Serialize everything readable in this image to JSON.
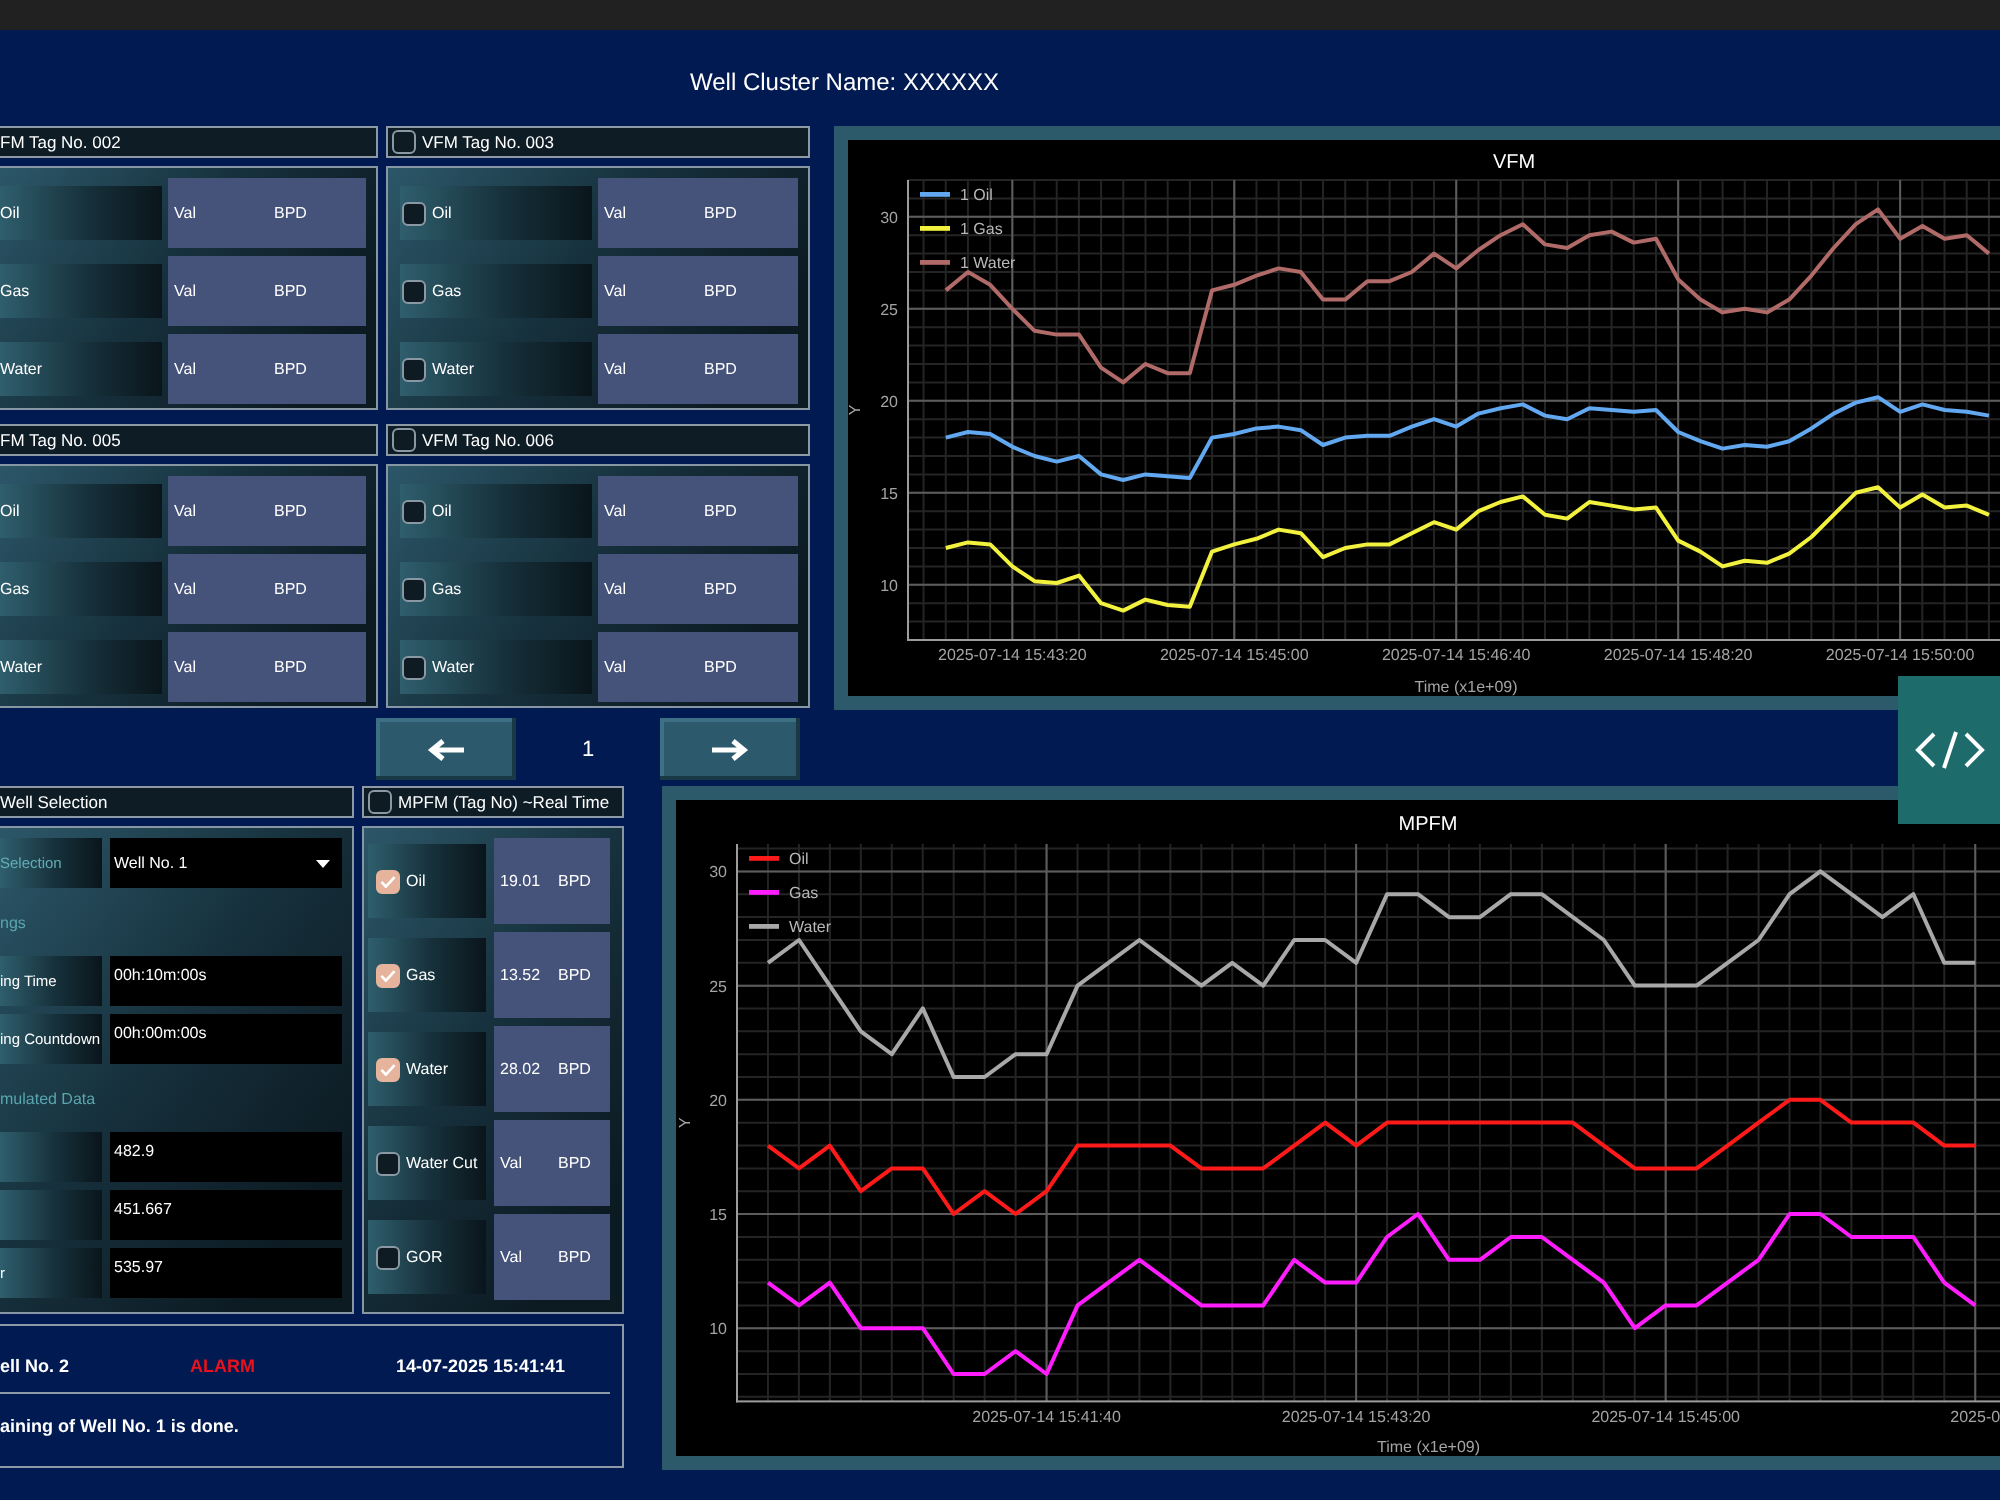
{
  "header": {
    "title": "Well Cluster Name: XXXXXX"
  },
  "vfm_panels": [
    {
      "title": "FM Tag No. 002",
      "rows": [
        {
          "label": "Oil",
          "value": "Val",
          "unit": "BPD"
        },
        {
          "label": "Gas",
          "value": "Val",
          "unit": "BPD"
        },
        {
          "label": "Water",
          "value": "Val",
          "unit": "BPD"
        }
      ]
    },
    {
      "title": "VFM Tag No. 003",
      "checked": false,
      "rows": [
        {
          "label": "Oil",
          "checked": false,
          "value": "Val",
          "unit": "BPD"
        },
        {
          "label": "Gas",
          "checked": false,
          "value": "Val",
          "unit": "BPD"
        },
        {
          "label": "Water",
          "checked": false,
          "value": "Val",
          "unit": "BPD"
        }
      ]
    },
    {
      "title": "FM Tag No. 005",
      "rows": [
        {
          "label": "Oil",
          "value": "Val",
          "unit": "BPD"
        },
        {
          "label": "Gas",
          "value": "Val",
          "unit": "BPD"
        },
        {
          "label": "Water",
          "value": "Val",
          "unit": "BPD"
        }
      ]
    },
    {
      "title": "VFM Tag No. 006",
      "checked": false,
      "rows": [
        {
          "label": "Oil",
          "checked": false,
          "value": "Val",
          "unit": "BPD"
        },
        {
          "label": "Gas",
          "checked": false,
          "value": "Val",
          "unit": "BPD"
        },
        {
          "label": "Water",
          "checked": false,
          "value": "Val",
          "unit": "BPD"
        }
      ]
    }
  ],
  "pager": {
    "page": "1"
  },
  "well_selection": {
    "title": "Well Selection",
    "rows": [
      {
        "kind": "dropdown",
        "label": "Selection",
        "value": "Well No. 1"
      },
      {
        "kind": "heading",
        "label": "ngs"
      },
      {
        "kind": "input",
        "label": "ing Time",
        "value": "00h:10m:00s"
      },
      {
        "kind": "readout",
        "label": "ing Countdown",
        "value": "00h:00m:00s"
      },
      {
        "kind": "heading",
        "label": "mulated Data"
      },
      {
        "kind": "readout",
        "value": "482.9"
      },
      {
        "kind": "readout",
        "value": "451.667"
      },
      {
        "kind": "readout",
        "label": "r",
        "value": "535.97"
      }
    ]
  },
  "mpfm_panel": {
    "title": "MPFM (Tag No) ~Real Time",
    "checked": false,
    "rows": [
      {
        "label": "Oil",
        "checked": true,
        "value": "19.01",
        "unit": "BPD"
      },
      {
        "label": "Gas",
        "checked": true,
        "value": "13.52",
        "unit": "BPD"
      },
      {
        "label": "Water",
        "checked": true,
        "value": "28.02",
        "unit": "BPD"
      },
      {
        "label": "Water Cut",
        "checked": false,
        "value": "Val",
        "unit": "BPD"
      },
      {
        "label": "GOR",
        "checked": false,
        "value": "Val",
        "unit": "BPD"
      }
    ]
  },
  "alarm": {
    "well": "ell No. 2",
    "status": "ALARM",
    "time": "14-07-2025 15:41:41",
    "message": "aining of Well No. 1 is done."
  },
  "vfm_chart": {
    "chart_data": {
      "type": "line",
      "title": "VFM",
      "xlabel": "Time (x1e+09)",
      "ylabel": "Y",
      "grid": true,
      "legend": "upper left",
      "categories": [
        null,
        null,
        null,
        "2025-07-14 15:43:20",
        null,
        null,
        null,
        null,
        null,
        null,
        null,
        null,
        null,
        "2025-07-14 15:45:00",
        null,
        null,
        null,
        null,
        null,
        null,
        null,
        null,
        null,
        "2025-07-14 15:46:40",
        null,
        null,
        null,
        null,
        null,
        null,
        null,
        null,
        null,
        "2025-07-14 15:48:20",
        null,
        null,
        null,
        null,
        null,
        null,
        null,
        null,
        null,
        "2025-07-14 15:50:00",
        null,
        null,
        null,
        null
      ],
      "series": [
        {
          "name": "1 Oil",
          "color": "#62a8f0",
          "values": [
            18,
            18.3,
            18.2,
            17.5,
            17,
            16.7,
            17,
            16,
            15.7,
            16,
            15.9,
            15.8,
            18,
            18.2,
            18.5,
            18.6,
            18.4,
            17.6,
            18,
            18.1,
            18.1,
            18.6,
            19,
            18.6,
            19.3,
            19.6,
            19.8,
            19.2,
            19,
            19.6,
            19.5,
            19.4,
            19.5,
            18.3,
            17.8,
            17.4,
            17.6,
            17.5,
            17.8,
            18.5,
            19.3,
            19.9,
            20.2,
            19.4,
            19.8,
            19.5,
            19.4,
            19.2
          ]
        },
        {
          "name": "1 Gas",
          "color": "#f2f23e",
          "values": [
            12,
            12.3,
            12.2,
            11,
            10.2,
            10.1,
            10.5,
            9,
            8.6,
            9.2,
            8.9,
            8.8,
            11.8,
            12.2,
            12.5,
            13,
            12.8,
            11.5,
            12,
            12.2,
            12.2,
            12.8,
            13.4,
            13,
            14,
            14.5,
            14.8,
            13.8,
            13.6,
            14.5,
            14.3,
            14.1,
            14.2,
            12.4,
            11.8,
            11,
            11.3,
            11.2,
            11.7,
            12.6,
            13.8,
            15,
            15.3,
            14.2,
            14.9,
            14.2,
            14.3,
            13.8
          ]
        },
        {
          "name": "1 Water",
          "color": "#b06a68",
          "values": [
            26,
            27,
            26.3,
            25,
            23.8,
            23.6,
            23.6,
            21.8,
            21,
            22,
            21.5,
            21.5,
            26,
            26.3,
            26.8,
            27.2,
            27,
            25.5,
            25.5,
            26.5,
            26.5,
            27,
            28,
            27.2,
            28.2,
            29,
            29.6,
            28.5,
            28.3,
            29,
            29.2,
            28.6,
            28.8,
            26.6,
            25.5,
            24.8,
            25,
            24.8,
            25.5,
            26.8,
            28.3,
            29.6,
            30.4,
            28.8,
            29.5,
            28.8,
            29,
            28
          ]
        }
      ],
      "ylim": [
        7,
        32
      ],
      "yticks": [
        10,
        15,
        20,
        25,
        30
      ]
    }
  },
  "mpfm_chart": {
    "chart_data": {
      "type": "line",
      "title": "MPFM",
      "xlabel": "Time (x1e+09)",
      "ylabel": "Y",
      "grid": true,
      "legend": "upper left",
      "categories": [
        null,
        null,
        null,
        null,
        null,
        null,
        null,
        null,
        null,
        "2025-07-14 15:41:40",
        null,
        null,
        null,
        null,
        null,
        null,
        null,
        null,
        null,
        "2025-07-14 15:43:20",
        null,
        null,
        null,
        null,
        null,
        null,
        null,
        null,
        null,
        "2025-07-14 15:45:00",
        null,
        null,
        null,
        null,
        null,
        null,
        null,
        null,
        null,
        "2025-0"
      ],
      "series": [
        {
          "name": "Oil",
          "color": "#ff1a1a",
          "values": [
            18,
            17,
            18,
            16,
            17,
            17,
            15,
            16,
            15,
            16,
            18,
            18,
            18,
            18,
            17,
            17,
            17,
            18,
            19,
            18,
            19,
            19,
            19,
            19,
            19,
            19,
            19,
            18,
            17,
            17,
            17,
            18,
            19,
            20,
            20,
            19,
            19,
            19,
            18,
            18
          ]
        },
        {
          "name": "Gas",
          "color": "#ff1cff",
          "values": [
            12,
            11,
            12,
            10,
            10,
            10,
            8,
            8,
            9,
            8,
            11,
            12,
            13,
            12,
            11,
            11,
            11,
            13,
            12,
            12,
            14,
            15,
            13,
            13,
            14,
            14,
            13,
            12,
            10,
            11,
            11,
            12,
            13,
            15,
            15,
            14,
            14,
            14,
            12,
            11
          ]
        },
        {
          "name": "Water",
          "color": "#a8a8a8",
          "values": [
            26,
            27,
            25,
            23,
            22,
            24,
            21,
            21,
            22,
            22,
            25,
            26,
            27,
            26,
            25,
            26,
            25,
            27,
            27,
            26,
            29,
            29,
            28,
            28,
            29,
            29,
            28,
            27,
            25,
            25,
            25,
            26,
            27,
            29,
            30,
            29,
            28,
            29,
            26,
            26
          ]
        }
      ],
      "ylim": [
        6.8,
        31.2
      ],
      "yticks": [
        10,
        15,
        20,
        25,
        30
      ]
    }
  }
}
